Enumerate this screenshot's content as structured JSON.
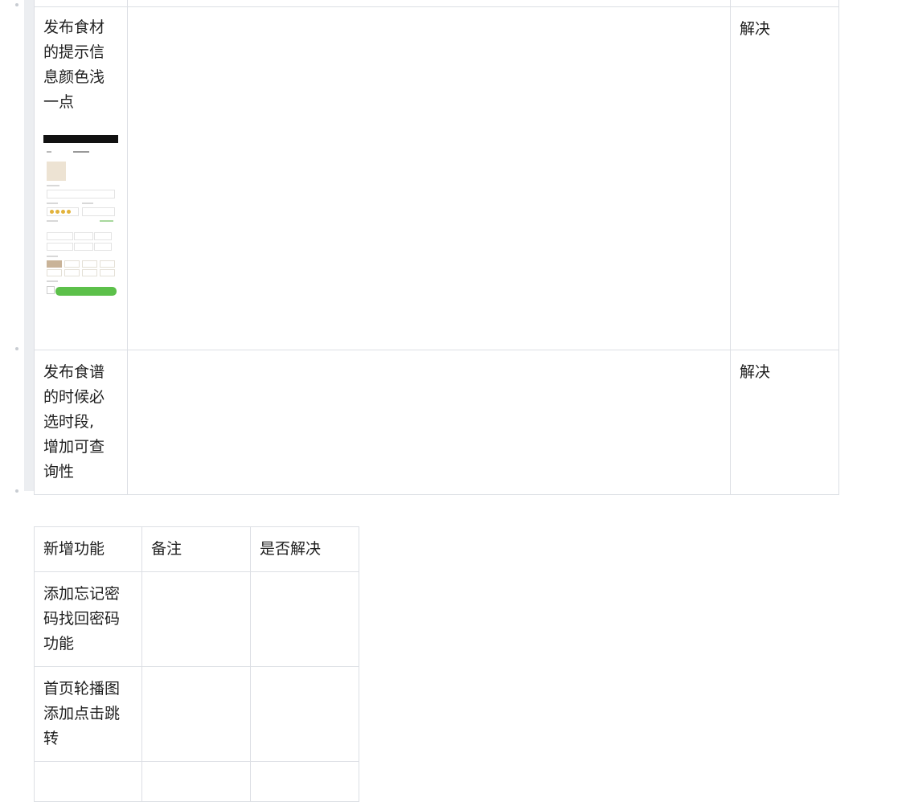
{
  "table1": {
    "rows": [
      {
        "issue": "发布食材\n的提示信\n息颜色浅\n一点",
        "note": "",
        "status": "解决"
      },
      {
        "issue": "发布食谱\n的时候必\n选时段,\n增加可查\n询性",
        "note": "",
        "status": "解决"
      }
    ]
  },
  "table2": {
    "headers": [
      "新增功能",
      "备注",
      "是否解决"
    ],
    "rows": [
      {
        "feature": "添加忘记密\n码找回密码\n功能",
        "note": "",
        "status": ""
      },
      {
        "feature": "首页轮播图\n添加点击跳\n转",
        "note": "",
        "status": ""
      },
      {
        "feature": "",
        "note": "",
        "status": ""
      }
    ]
  },
  "colors": {
    "accent_green": "#5cc04a",
    "star": "#e2b33c",
    "border": "#dcdfe4"
  },
  "icons": [
    "bullet-dot",
    "phone-screenshot-thumbnail"
  ]
}
